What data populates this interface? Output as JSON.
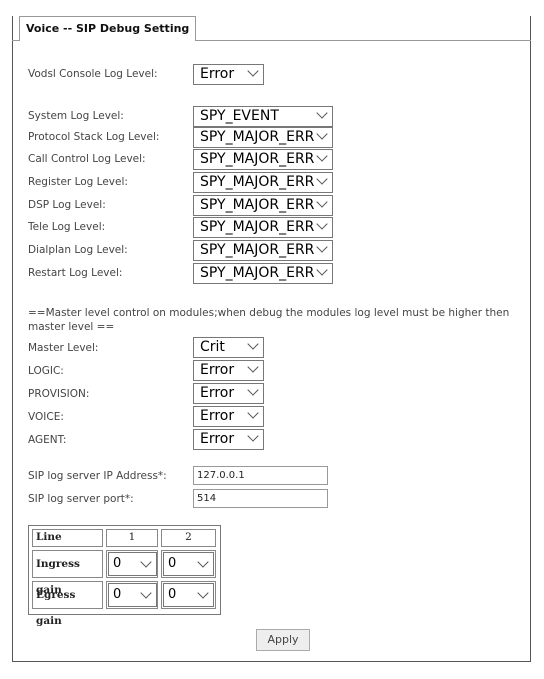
{
  "tab": {
    "title": "Voice -- SIP Debug Setting"
  },
  "vodsl": {
    "label": "Vodsl Console Log Level:",
    "value": "Error"
  },
  "logs": [
    {
      "label": "System Log Level:",
      "value": "SPY_EVENT"
    },
    {
      "label": "Protocol Stack Log Level:",
      "value": "SPY_MAJOR_ERR"
    },
    {
      "label": "Call Control Log Level:",
      "value": "SPY_MAJOR_ERR"
    },
    {
      "label": "Register Log Level:",
      "value": "SPY_MAJOR_ERR"
    },
    {
      "label": "DSP Log Level:",
      "value": "SPY_MAJOR_ERR"
    },
    {
      "label": "Tele Log Level:",
      "value": "SPY_MAJOR_ERR"
    },
    {
      "label": "Dialplan Log Level:",
      "value": "SPY_MAJOR_ERR"
    },
    {
      "label": "Restart Log Level:",
      "value": "SPY_MAJOR_ERR"
    }
  ],
  "note": "==Master level control on modules;when debug the modules log level must be higher then master level ==",
  "modules": [
    {
      "label": "Master Level:",
      "value": "Crit"
    },
    {
      "label": "LOGIC:",
      "value": "Error"
    },
    {
      "label": "PROVISION:",
      "value": "Error"
    },
    {
      "label": "VOICE:",
      "value": "Error"
    },
    {
      "label": "AGENT:",
      "value": "Error"
    }
  ],
  "server": {
    "ip_label": "SIP log server IP Address*:",
    "ip_value": "127.0.0.1",
    "port_label": "SIP log server port*:",
    "port_value": "514"
  },
  "gain": {
    "line_label": "Line",
    "line1": "1",
    "line2": "2",
    "ingress_label": "Ingress gain",
    "ingress1": "0",
    "ingress2": "0",
    "egress_label": "Egress gain",
    "egress1": "0",
    "egress2": "0"
  },
  "apply_label": "Apply"
}
